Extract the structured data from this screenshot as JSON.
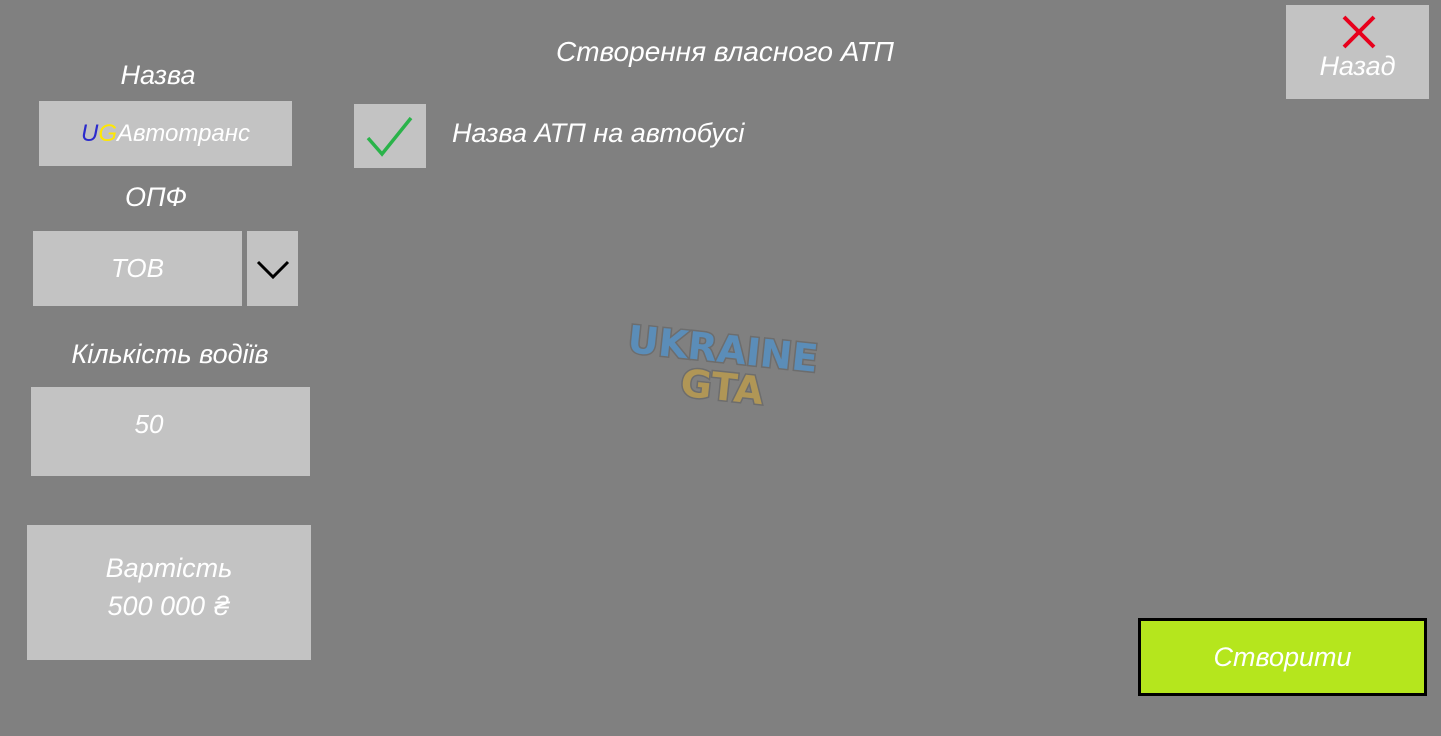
{
  "header": {
    "title": "Створення власного АТП",
    "back_label": "Назад",
    "back_icon": "close-icon"
  },
  "form": {
    "name_label": "Назва",
    "name_value": {
      "prefix_u": "U",
      "prefix_g": "G",
      "rest": "Автотранс"
    },
    "opf_label": "ОПФ",
    "opf_value": "ТОВ",
    "opf_icon": "chevron-down-icon",
    "drivers_label": "Кількість водіїв",
    "drivers_value": "50",
    "cost_label": "Вартість",
    "cost_value": "500 000 ₴"
  },
  "option": {
    "checked": true,
    "label": "Назва АТП на автобусі"
  },
  "actions": {
    "create_label": "Створити"
  },
  "logo": {
    "text_line1": "UKRAINE",
    "text_line2": "GTA"
  },
  "colors": {
    "background": "#808080",
    "field": "#c3c3c3",
    "create_button": "#b5e61d",
    "check": "#2ab34a",
    "close": "#e8001c",
    "accent_u": "#2a2acc",
    "accent_g": "#ffe800"
  }
}
